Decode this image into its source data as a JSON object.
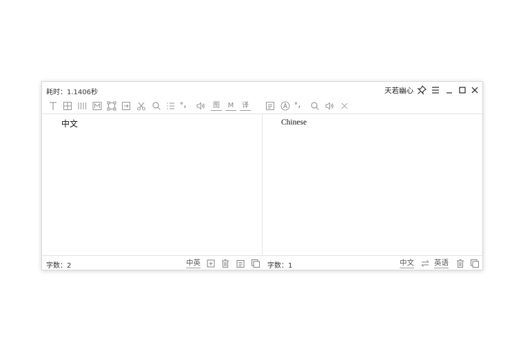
{
  "window": {
    "time_label": "耗时：1.1406秒",
    "brand": "天若幽心"
  },
  "source": {
    "text": "中文",
    "count_label": "字数：2",
    "lang_toggle": "中英"
  },
  "target": {
    "text": "Chinese",
    "count_label": "字数：1",
    "from_lang": "中文",
    "to_lang": "英语"
  },
  "toolbar": {
    "graph_label": "图",
    "m_label": "M",
    "translate_label": "译",
    "tone_label": "°，",
    "right_tone_label": "°，"
  }
}
